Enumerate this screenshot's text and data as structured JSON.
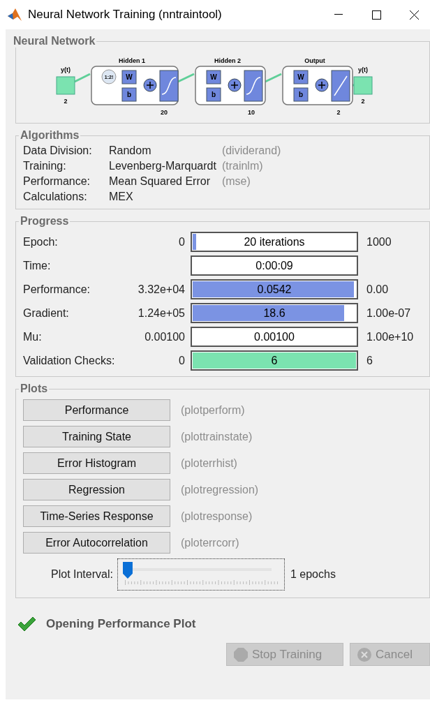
{
  "window": {
    "title": "Neural Network Training (nntraintool)"
  },
  "network": {
    "title": "Neural Network",
    "input": {
      "label": "y(t)",
      "size": "2"
    },
    "layers": [
      {
        "title": "Hidden 1",
        "size": "20",
        "delay": "1:2!",
        "weight": "W",
        "bias": "b",
        "kind": "sigmoid"
      },
      {
        "title": "Hidden 2",
        "size": "10",
        "weight": "W",
        "bias": "b",
        "kind": "sigmoid"
      },
      {
        "title": "Output",
        "size": "2",
        "weight": "W",
        "bias": "b",
        "kind": "linear"
      }
    ],
    "output": {
      "label": "y(t)",
      "size": "2"
    }
  },
  "algorithms": {
    "title": "Algorithms",
    "rows": [
      {
        "label": "Data Division:",
        "value": "Random",
        "code": "(dividerand)"
      },
      {
        "label": "Training:",
        "value": "Levenberg-Marquardt",
        "code": "(trainlm)"
      },
      {
        "label": "Performance:",
        "value": "Mean Squared Error",
        "code": "(mse)"
      },
      {
        "label": "Calculations:",
        "value": "MEX"
      }
    ]
  },
  "progress": {
    "title": "Progress",
    "rows": [
      {
        "label": "Epoch:",
        "start": "0",
        "value": "20 iterations",
        "end": "1000",
        "level": 0.02,
        "color": "#7b93e3"
      },
      {
        "label": "Time:",
        "value": "0:00:09"
      },
      {
        "label": "Performance:",
        "start": "3.32e+04",
        "value": "0.0542",
        "end": "0.00",
        "level": 0.98,
        "color": "#7b93e3"
      },
      {
        "label": "Gradient:",
        "start": "1.24e+05",
        "value": "18.6",
        "end": "1.00e-07",
        "level": 0.92,
        "color": "#7b93e3"
      },
      {
        "label": "Mu:",
        "start": "0.00100",
        "value": "0.00100",
        "end": "1.00e+10"
      },
      {
        "label": "Validation Checks:",
        "start": "0",
        "value": "6",
        "end": "6",
        "level": 1,
        "color": "#7be3b0"
      }
    ]
  },
  "plots": {
    "title": "Plots",
    "buttons": [
      {
        "label": "Performance",
        "code": "(plotperform)"
      },
      {
        "label": "Training State",
        "code": "(plottrainstate)"
      },
      {
        "label": "Error Histogram",
        "code": "(ploterrhist)"
      },
      {
        "label": "Regression",
        "code": "(plotregression)"
      },
      {
        "label": "Time-Series Response",
        "code": "(plotresponse)"
      },
      {
        "label": "Error Autocorrelation",
        "code": "(ploterrcorr)"
      }
    ],
    "interval": {
      "label": "Plot Interval:",
      "level": 0,
      "reading": "1 epochs"
    }
  },
  "status": {
    "text": "Opening Performance Plot"
  },
  "buttons": [
    {
      "label": "Stop Training",
      "kind": "stop",
      "disabled": true
    },
    {
      "label": "Cancel",
      "kind": "cancel",
      "disabled": true
    }
  ]
}
